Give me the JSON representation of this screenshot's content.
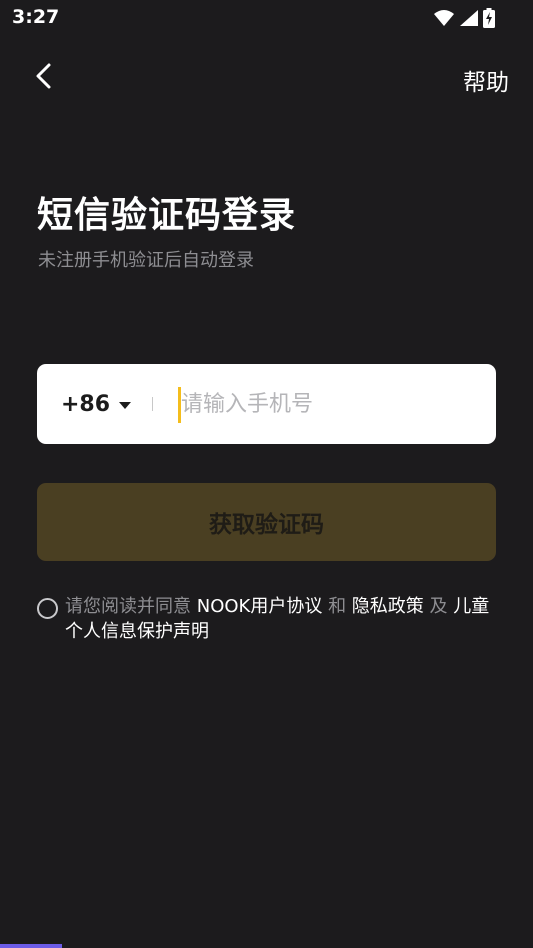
{
  "status_bar": {
    "time": "3:27",
    "icons": [
      "wifi-icon",
      "cellular-signal-icon",
      "battery-charging-icon"
    ]
  },
  "header": {
    "back_icon": "chevron-left-icon",
    "help_label": "帮助"
  },
  "title": "短信验证码登录",
  "subtitle": "未注册手机验证后自动登录",
  "phone_form": {
    "country_code": "+86",
    "dropdown_icon": "caret-down-icon",
    "placeholder": "请输入手机号",
    "value": ""
  },
  "get_code_button": "获取验证码",
  "agreement": {
    "prefix": "请您阅读并同意 ",
    "user_agreement": "NOOK用户协议",
    "and_1": " 和 ",
    "privacy_policy": "隐私政策",
    "and_2": " 及 ",
    "children_privacy": "儿童个人信息保护声明",
    "checked": false
  },
  "colors": {
    "background": "#1c1b1d",
    "accent": "#f4bd1c",
    "button_disabled": "#4a3f22",
    "muted_text": "#8e8e92"
  }
}
